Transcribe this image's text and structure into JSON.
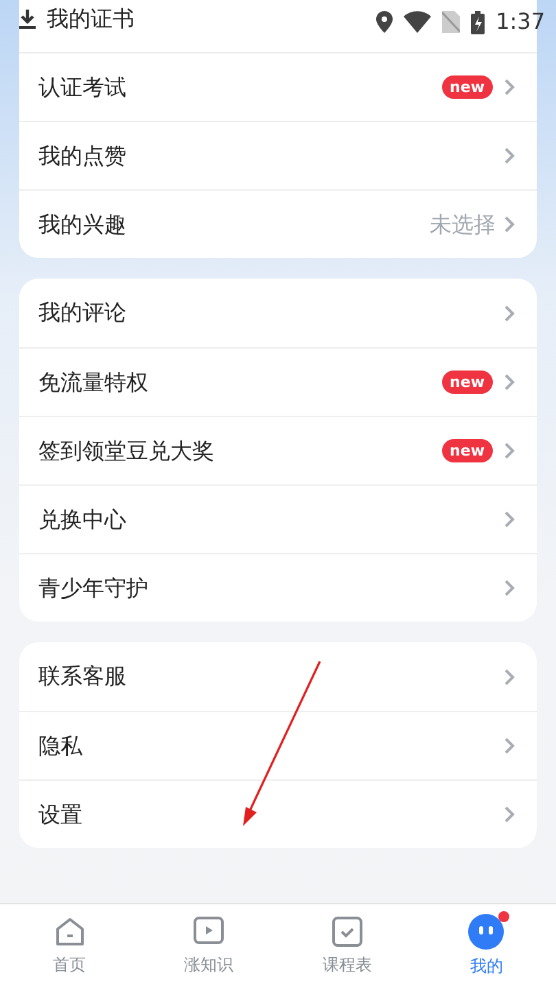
{
  "status_bar": {
    "time": "1:37"
  },
  "groups": [
    {
      "items": [
        {
          "label": "我的证书"
        },
        {
          "label": "认证考试",
          "badge": "new"
        },
        {
          "label": "我的点赞"
        },
        {
          "label": "我的兴趣",
          "value": "未选择"
        }
      ]
    },
    {
      "items": [
        {
          "label": "我的评论"
        },
        {
          "label": "免流量特权",
          "badge": "new"
        },
        {
          "label": "签到领堂豆兑大奖",
          "badge": "new"
        },
        {
          "label": "兑换中心"
        },
        {
          "label": "青少年守护"
        }
      ]
    },
    {
      "items": [
        {
          "label": "联系客服"
        },
        {
          "label": "隐私"
        },
        {
          "label": "设置"
        }
      ]
    }
  ],
  "tab_bar": [
    {
      "label": "首页",
      "selected": false
    },
    {
      "label": "涨知识",
      "selected": false
    },
    {
      "label": "课程表",
      "selected": false
    },
    {
      "label": "我的",
      "selected": true,
      "dot": true
    }
  ]
}
